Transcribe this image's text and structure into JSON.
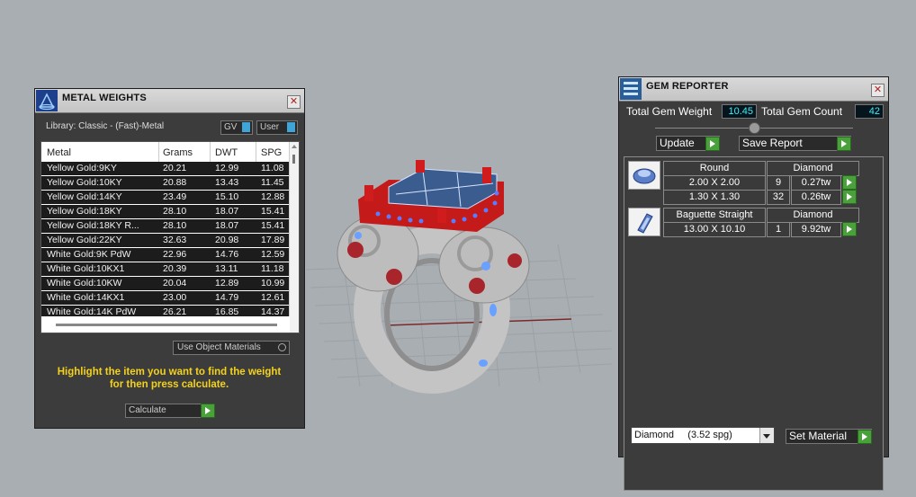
{
  "viewport": {
    "background": "#a9aeb3"
  },
  "metal_weights": {
    "title": "METAL WEIGHTS",
    "close": "✕",
    "library_label": "Library: Classic - (Fast)-Metal",
    "gv_label": "GV",
    "user_label": "User",
    "columns": [
      "Metal",
      "Grams",
      "DWT",
      "SPG"
    ],
    "rows": [
      [
        "Yellow Gold:9KY",
        "20.21",
        "12.99",
        "11.08"
      ],
      [
        "Yellow Gold:10KY",
        "20.88",
        "13.43",
        "11.45"
      ],
      [
        "Yellow Gold:14KY",
        "23.49",
        "15.10",
        "12.88"
      ],
      [
        "Yellow Gold:18KY",
        "28.10",
        "18.07",
        "15.41"
      ],
      [
        "Yellow Gold:18KY R...",
        "28.10",
        "18.07",
        "15.41"
      ],
      [
        "Yellow Gold:22KY",
        "32.63",
        "20.98",
        "17.89"
      ],
      [
        "White Gold:9K PdW",
        "22.96",
        "14.76",
        "12.59"
      ],
      [
        "White Gold:10KX1",
        "20.39",
        "13.11",
        "11.18"
      ],
      [
        "White Gold:10KW",
        "20.04",
        "12.89",
        "10.99"
      ],
      [
        "White Gold:14KX1",
        "23.00",
        "14.79",
        "12.61"
      ],
      [
        "White Gold:14K PdW",
        "26.21",
        "16.85",
        "14.37"
      ]
    ],
    "use_object_materials": "Use Object Materials",
    "hint": "Highlight the item you want to find the weight for then press calculate.",
    "calculate": "Calculate",
    "hint_color": "#f4d21b"
  },
  "gem_reporter": {
    "title": "GEM REPORTER",
    "close": "✕",
    "total_gem_weight_label": "Total Gem Weight",
    "total_gem_weight": "10.45",
    "total_gem_count_label": "Total Gem Count",
    "total_gem_count": "42",
    "update": "Update",
    "save_report": "Save Report",
    "groups": [
      {
        "icon": "round-gem-icon",
        "shape": "Round",
        "material": "Diamond",
        "rows": [
          {
            "size": "2.00 X 2.00",
            "count": "9",
            "weight": "0.27tw"
          },
          {
            "size": "1.30 X 1.30",
            "count": "32",
            "weight": "0.26tw"
          }
        ]
      },
      {
        "icon": "baguette-gem-icon",
        "shape": "Baguette Straight",
        "material": "Diamond",
        "rows": [
          {
            "size": "13.00 X 10.10",
            "count": "1",
            "weight": "9.92tw"
          }
        ]
      }
    ],
    "material_select": "Diamond     (3.52 spg)",
    "set_material": "Set Material",
    "value_color": "#3cf0f4"
  }
}
